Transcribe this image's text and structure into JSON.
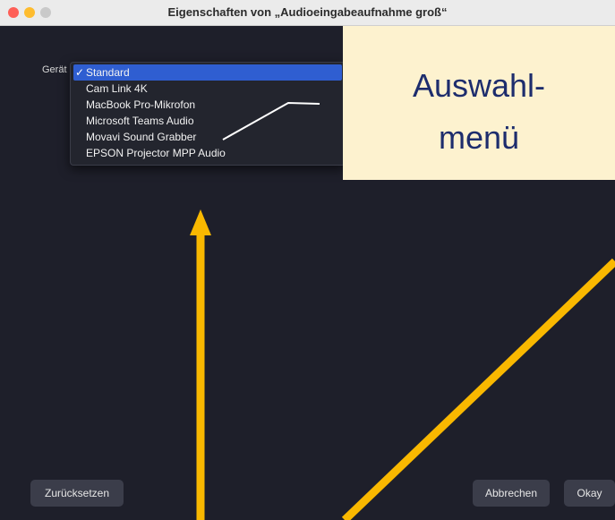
{
  "window": {
    "title": "Eigenschaften von „Audioeingabeaufnahme groß“"
  },
  "device": {
    "label": "Gerät",
    "checkmark": "✓",
    "options": [
      "Standard",
      "Cam Link 4K",
      "MacBook Pro-Mikrofon",
      "Microsoft Teams Audio",
      "Movavi Sound Grabber",
      "EPSON Projector MPP Audio"
    ],
    "selected": "Standard"
  },
  "callout": {
    "text": "Auswahl-\nmenü"
  },
  "buttons": {
    "reset": "Zurücksetzen",
    "cancel": "Abbrechen",
    "ok": "Okay"
  },
  "colors": {
    "background": "#1e1f2a",
    "selection": "#2f5ed1",
    "callout_bg": "#fdf2cf",
    "callout_text": "#1d2d6d",
    "arrow": "#f9b800"
  }
}
